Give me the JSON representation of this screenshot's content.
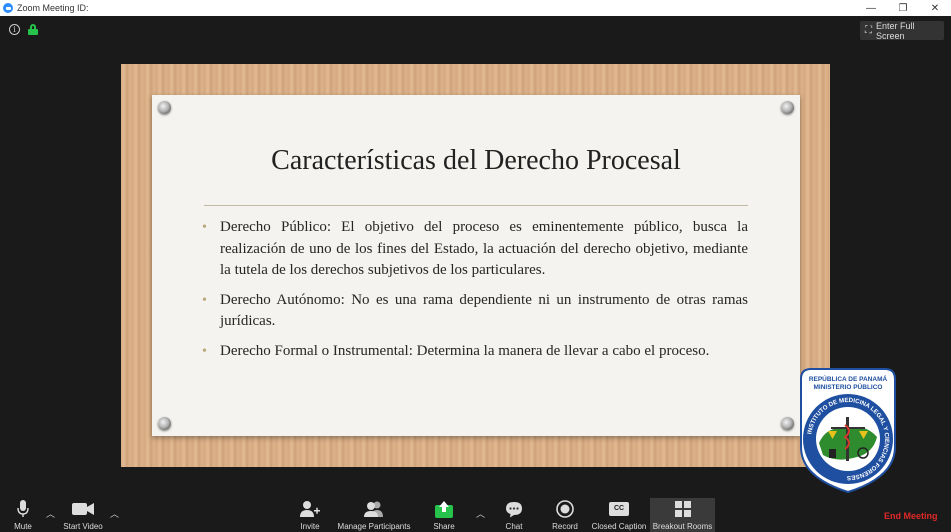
{
  "window": {
    "title": "Zoom Meeting ID:",
    "controls": [
      "—",
      "❐",
      "✕"
    ]
  },
  "header": {
    "fullscreen_label": "Enter Full Screen"
  },
  "slide": {
    "title": "Características del Derecho Procesal",
    "bullets": [
      "Derecho Público: El objetivo del proceso es eminentemente público, busca la realización de uno de los fines del Estado, la actuación del derecho objetivo, mediante la tutela de los derechos subjetivos de los particulares.",
      "Derecho Autónomo: No es una rama dependiente ni un instrumento de otras ramas jurídicas.",
      "Derecho Formal o Instrumental: Determina la manera de llevar a cabo el proceso."
    ]
  },
  "logo": {
    "top_line1": "REPÚBLICA DE PANAMÁ",
    "top_line2": "MINISTERIO PÚBLICO",
    "ring_text": "INSTITUTO DE MEDICINA LEGAL Y CIENCIAS FORENSES"
  },
  "toolbar": {
    "mute": "Mute",
    "start_video": "Start Video",
    "invite": "Invite",
    "manage_participants": "Manage Participants",
    "share": "Share",
    "chat": "Chat",
    "record": "Record",
    "closed_caption": "Closed Caption",
    "cc_badge": "CC",
    "breakout_rooms": "Breakout Rooms",
    "end_meeting": "End Meeting"
  },
  "colors": {
    "share_green": "#27c24c",
    "end_meeting_red": "#e02828",
    "zoom_blue": "#2d8cff",
    "logo_blue": "#1f4fa0"
  }
}
